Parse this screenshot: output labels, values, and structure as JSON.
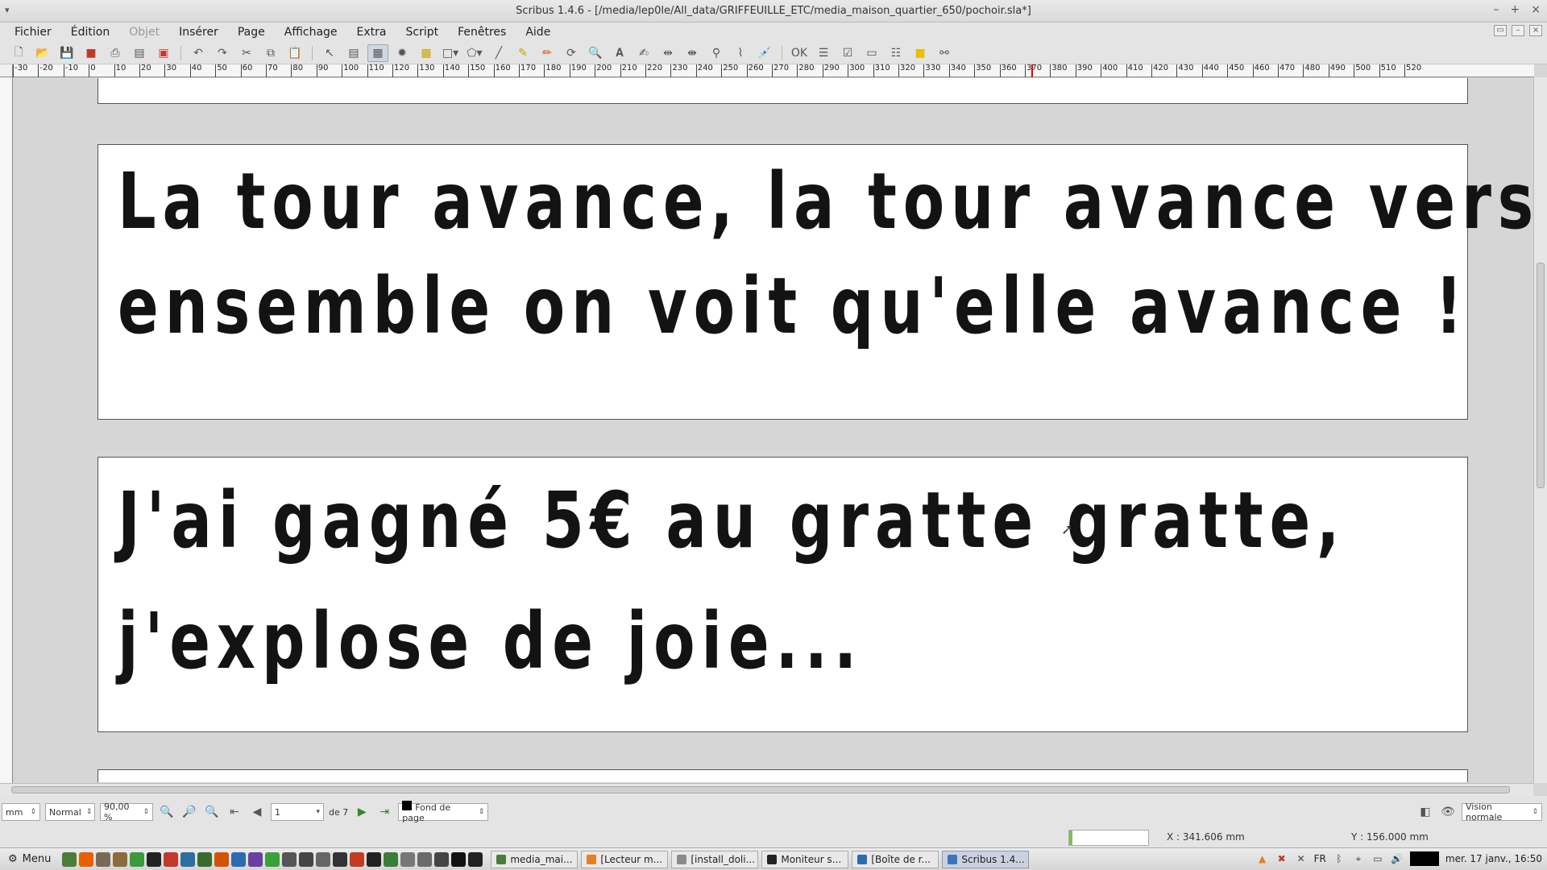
{
  "window": {
    "title": "Scribus 1.4.6 - [/media/lep0le/All_data/GRIFFEUILLE_ETC/media_maison_quartier_650/pochoir.sla*]"
  },
  "menubar": {
    "items": [
      {
        "label": "Fichier",
        "enabled": true
      },
      {
        "label": "Édition",
        "enabled": true
      },
      {
        "label": "Objet",
        "enabled": false
      },
      {
        "label": "Insérer",
        "enabled": true
      },
      {
        "label": "Page",
        "enabled": true
      },
      {
        "label": "Affichage",
        "enabled": true
      },
      {
        "label": "Extra",
        "enabled": true
      },
      {
        "label": "Script",
        "enabled": true
      },
      {
        "label": "Fenêtres",
        "enabled": true
      },
      {
        "label": "Aide",
        "enabled": true
      }
    ]
  },
  "toolbar": {
    "icons": [
      "new-document-icon",
      "open-icon",
      "save-icon",
      "close-icon",
      "print-icon",
      "preflight-icon",
      "export-pdf-icon",
      "undo-icon",
      "redo-icon",
      "cut-icon",
      "copy-icon",
      "paste-icon",
      "select-icon",
      "text-frame-icon",
      "image-frame-icon",
      "render-frame-icon",
      "table-icon",
      "shape-icon",
      "polygon-icon",
      "line-icon",
      "bezier-icon",
      "freehand-icon",
      "rotate-icon",
      "zoom-icon",
      "edit-content-icon",
      "edit-text-icon",
      "link-frames-icon",
      "unlink-frames-icon",
      "measure-icon",
      "copy-properties-icon",
      "eyedropper-icon",
      "pdf-button-icon",
      "pdf-textfield-icon",
      "pdf-checkbox-icon",
      "pdf-combobox-icon",
      "pdf-listbox-icon",
      "pdf-annotation-icon",
      "pdf-link-icon"
    ]
  },
  "ruler": {
    "unit": "mm",
    "labels": [
      "-30",
      "-20",
      "-10",
      "0",
      "10",
      "20",
      "30",
      "40",
      "50",
      "60",
      "70",
      "80",
      "90",
      "100",
      "110",
      "120",
      "130",
      "140",
      "150",
      "160",
      "170",
      "180",
      "190",
      "200",
      "210",
      "220",
      "230",
      "240",
      "250",
      "260",
      "270",
      "280",
      "290",
      "300",
      "310",
      "320",
      "330",
      "340",
      "350",
      "360",
      "370",
      "380",
      "390",
      "400",
      "410",
      "420",
      "430",
      "440",
      "450",
      "460",
      "470",
      "480",
      "490",
      "500",
      "510",
      "520"
    ]
  },
  "document": {
    "frames": [
      {
        "lines": []
      },
      {
        "lines": [
          "La tour avance, la tour avance vers nous,",
          "ensemble on voit qu'elle avance !"
        ]
      },
      {
        "lines": [
          "J'ai gagné 5€ au gratte gratte,",
          "j'explose de joie..."
        ]
      },
      {
        "lines": []
      }
    ]
  },
  "statusbar": {
    "unit": "mm",
    "mode": "Normal",
    "zoom": "90,00 %",
    "page_current": "1",
    "page_total_label": "de 7",
    "layer": "Fond de page",
    "view_mode": "Vision normale",
    "x_coord": "X : 341.606 mm",
    "y_coord": "Y : 156.000 mm"
  },
  "taskbar": {
    "menu_label": "Menu",
    "launchers": [
      {
        "name": "files-icon",
        "color": "#4a7d3a"
      },
      {
        "name": "firefox-icon",
        "color": "#e66000"
      },
      {
        "name": "gimp-icon",
        "color": "#7a6a55"
      },
      {
        "name": "app-icon",
        "color": "#8a6d3b"
      },
      {
        "name": "chromium-icon",
        "color": "#3b9a3b"
      },
      {
        "name": "inkscape-icon",
        "color": "#222222"
      },
      {
        "name": "app-icon",
        "color": "#c0392b"
      },
      {
        "name": "app-icon",
        "color": "#2c6e9e"
      },
      {
        "name": "app-icon",
        "color": "#3a6b2a"
      },
      {
        "name": "app-icon",
        "color": "#d35400"
      },
      {
        "name": "vscode-icon",
        "color": "#2b6cb0"
      },
      {
        "name": "app-icon",
        "color": "#6b3fa0"
      },
      {
        "name": "app-icon",
        "color": "#3aa03a"
      },
      {
        "name": "app-icon",
        "color": "#555555"
      },
      {
        "name": "app-icon",
        "color": "#444444"
      },
      {
        "name": "app-icon",
        "color": "#666666"
      },
      {
        "name": "app-icon",
        "color": "#333333"
      },
      {
        "name": "app-icon",
        "color": "#c23b22"
      },
      {
        "name": "terminal-icon",
        "color": "#222222"
      },
      {
        "name": "app-icon",
        "color": "#3b7d3b"
      },
      {
        "name": "app-icon",
        "color": "#777777"
      },
      {
        "name": "app-icon",
        "color": "#6a6a6a"
      },
      {
        "name": "app-icon",
        "color": "#444444"
      },
      {
        "name": "app-icon",
        "color": "#111111"
      },
      {
        "name": "app-icon",
        "color": "#222222"
      }
    ],
    "windows": [
      {
        "label": "media_mai...",
        "icon_color": "#4a7d3a",
        "active": false
      },
      {
        "label": "[Lecteur m...",
        "icon_color": "#e67e22",
        "active": false
      },
      {
        "label": "[install_doli...",
        "icon_color": "#8a8a8a",
        "active": false
      },
      {
        "label": "Moniteur s...",
        "icon_color": "#222222",
        "active": false
      },
      {
        "label": "[Boîte de r...",
        "icon_color": "#2b6cb0",
        "active": false
      },
      {
        "label": "Scribus 1.4...",
        "icon_color": "#3a77b8",
        "active": true
      }
    ],
    "keyboard_layout": "FR",
    "clock": "mer. 17 janv., 16:50"
  }
}
